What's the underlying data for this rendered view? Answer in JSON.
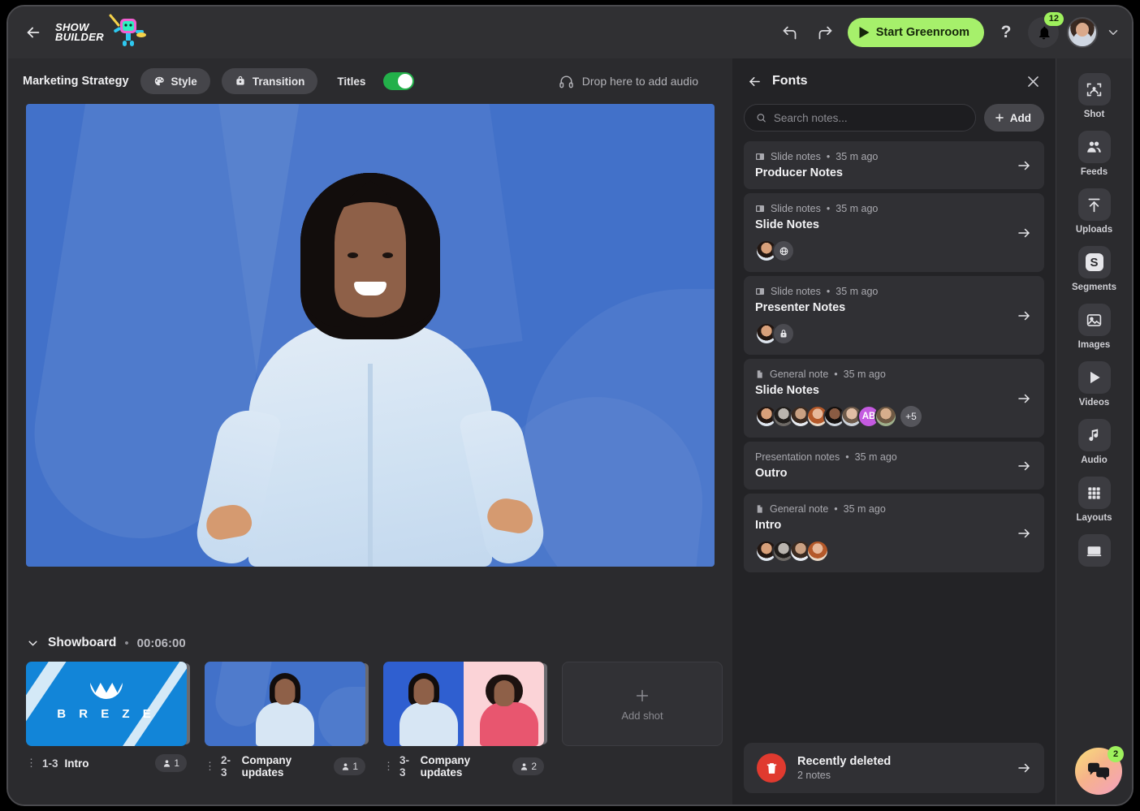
{
  "topbar": {
    "brand_line1": "SHOW",
    "brand_line2": "BUILDER",
    "back_icon": "arrow-left-icon",
    "undo_icon": "undo-icon",
    "redo_icon": "redo-icon",
    "start_button": "Start Greenroom",
    "help_label": "?",
    "notification_count": "12",
    "accent_green": "#a6f06b"
  },
  "subbar": {
    "doc_title": "Marketing Strategy",
    "style_label": "Style",
    "transition_label": "Transition",
    "titles_label": "Titles",
    "titles_on": true,
    "audio_drop_label": "Drop here to add audio"
  },
  "showboard": {
    "title": "Showboard",
    "separator": "•",
    "duration": "00:06:00",
    "add_shot_label": "Add shot",
    "shots": [
      {
        "number": "1-3",
        "name": "Intro",
        "people": "1",
        "art": "breze",
        "brand_word": "B R E Z E"
      },
      {
        "number": "2-3",
        "name": "Company updates",
        "people": "1",
        "art": "solo"
      },
      {
        "number": "3-3",
        "name": "Company updates",
        "people": "2",
        "art": "split"
      }
    ]
  },
  "notes_panel": {
    "title": "Fonts",
    "back_icon": "arrow-left-icon",
    "close_icon": "close-icon",
    "search_placeholder": "Search notes...",
    "search_value": "",
    "add_label": "Add",
    "notes": [
      {
        "kind": "Slide notes",
        "time": "35 m ago",
        "icon": "slide-icon",
        "title": "Producer Notes",
        "avatars": []
      },
      {
        "kind": "Slide notes",
        "time": "35 m ago",
        "icon": "slide-icon",
        "title": "Slide Notes",
        "avatars": [
          {
            "type": "photo",
            "tone": "a"
          },
          {
            "type": "badge",
            "glyph": "globe"
          }
        ]
      },
      {
        "kind": "Slide notes",
        "time": "35 m ago",
        "icon": "slide-icon",
        "title": "Presenter Notes",
        "avatars": [
          {
            "type": "photo",
            "tone": "a"
          },
          {
            "type": "badge",
            "glyph": "lock"
          }
        ]
      },
      {
        "kind": "General note",
        "time": "35 m ago",
        "icon": "doc-icon",
        "title": "Slide Notes",
        "avatars": [
          {
            "type": "photo",
            "tone": "a"
          },
          {
            "type": "photo",
            "tone": "b"
          },
          {
            "type": "photo",
            "tone": "c"
          },
          {
            "type": "photo",
            "tone": "d"
          },
          {
            "type": "photo",
            "tone": "e"
          },
          {
            "type": "photo",
            "tone": "f"
          },
          {
            "type": "initials",
            "label": "AB"
          },
          {
            "type": "photo",
            "tone": "g"
          }
        ],
        "overflow": "+5"
      },
      {
        "kind": "Presentation notes",
        "time": "35 m ago",
        "icon": "none",
        "title": "Outro",
        "avatars": []
      },
      {
        "kind": "General note",
        "time": "35 m ago",
        "icon": "doc-icon",
        "title": "Intro",
        "avatars": [
          {
            "type": "photo",
            "tone": "a"
          },
          {
            "type": "photo",
            "tone": "b"
          },
          {
            "type": "photo",
            "tone": "c"
          },
          {
            "type": "photo",
            "tone": "d"
          }
        ]
      }
    ],
    "recently_deleted": {
      "title": "Recently deleted",
      "subtitle": "2 notes",
      "icon": "trash-icon",
      "color": "#e03a2f"
    }
  },
  "rail": {
    "items": [
      {
        "label": "Shot",
        "icon": "shot-icon"
      },
      {
        "label": "Feeds",
        "icon": "people-icon"
      },
      {
        "label": "Uploads",
        "icon": "upload-icon"
      },
      {
        "label": "Segments",
        "icon": "segments-icon"
      },
      {
        "label": "Images",
        "icon": "image-icon"
      },
      {
        "label": "Videos",
        "icon": "play-icon"
      },
      {
        "label": "Audio",
        "icon": "music-note-icon"
      },
      {
        "label": "Layouts",
        "icon": "grid-icon"
      },
      {
        "label": "",
        "icon": "screen-icon"
      }
    ],
    "chat": {
      "icon": "chat-bubbles-icon",
      "badge": "2"
    }
  }
}
